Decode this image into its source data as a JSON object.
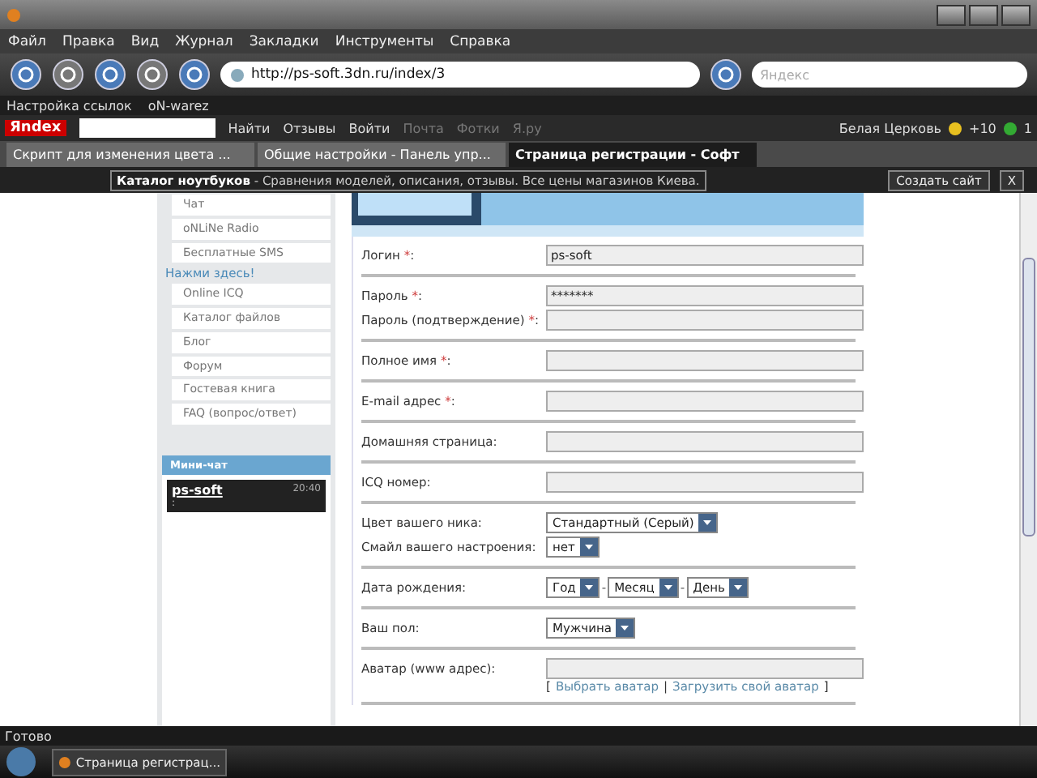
{
  "menu": [
    {
      "label": "Файл"
    },
    {
      "label": "Правка"
    },
    {
      "label": "Вид"
    },
    {
      "label": "Журнал"
    },
    {
      "label": "Закладки"
    },
    {
      "label": "Инструменты"
    },
    {
      "label": "Справка"
    }
  ],
  "nav": {
    "url": "http://ps-soft.3dn.ru/index/3",
    "search_placeholder": "Яндекс"
  },
  "bookmarks": [
    {
      "label": "Настройка ссылок"
    },
    {
      "label": "oN-warez"
    }
  ],
  "yandex_bar": {
    "logo": "Яndex",
    "find": "Найти",
    "items": [
      {
        "label": "Отзывы",
        "disabled": false
      },
      {
        "label": "Войти",
        "disabled": false
      },
      {
        "label": "Почта",
        "disabled": true
      },
      {
        "label": "Фотки",
        "disabled": true
      },
      {
        "label": "Я.ру",
        "disabled": true
      }
    ],
    "city": "Белая Церковь",
    "score": "+10",
    "count": "1"
  },
  "tabs": [
    {
      "label": "Скрипт для изменения цвета ...",
      "selected": false
    },
    {
      "label": "Общие настройки - Панель упр...",
      "selected": false
    },
    {
      "label": "Страница регистрации - Софт",
      "selected": true
    }
  ],
  "notice": {
    "title": "Каталог ноутбуков",
    "text": " - Сравнения моделей, описания, отзывы. Все цены магазинов Киева.",
    "button": "Создать сайт",
    "close": "X"
  },
  "sidebar": {
    "items_top": [
      {
        "label": "Чат"
      },
      {
        "label": "oNLiNe Radio"
      },
      {
        "label": "Бесплатные SMS"
      }
    ],
    "heading": "Нажми здесь!",
    "items": [
      {
        "label": "Online ICQ"
      },
      {
        "label": "Каталог файлов"
      },
      {
        "label": "Блог"
      },
      {
        "label": "Форум"
      },
      {
        "label": "Гостевая книга"
      },
      {
        "label": "FAQ (вопрос/ответ)"
      }
    ],
    "minichat": {
      "title": "Мини-чат",
      "user": "ps-soft",
      "time": "20:40",
      "text": ":"
    }
  },
  "form": [
    [
      {
        "label": "Логин ",
        "star": "*",
        "tail": ":",
        "controls": [
          {
            "kind": "input",
            "value": "ps-soft"
          }
        ]
      }
    ],
    [
      {
        "label": "Пароль ",
        "star": "*",
        "tail": ":",
        "controls": [
          {
            "kind": "input",
            "value": "*******"
          }
        ]
      },
      {
        "label": "Пароль (подтверждение) ",
        "star": "*",
        "tail": ":",
        "controls": [
          {
            "kind": "input"
          }
        ]
      }
    ],
    [
      {
        "label": "Полное имя ",
        "star": "*",
        "tail": ":",
        "controls": [
          {
            "kind": "input"
          }
        ]
      }
    ],
    [
      {
        "label": "E-mail адрес ",
        "star": "*",
        "tail": ":",
        "controls": [
          {
            "kind": "input"
          }
        ]
      }
    ],
    [
      {
        "label": "Домашняя страница:",
        "controls": [
          {
            "kind": "input"
          }
        ]
      }
    ],
    [
      {
        "label": "ICQ номер:",
        "controls": [
          {
            "kind": "input"
          }
        ]
      }
    ],
    [
      {
        "label": "Цвет вашего ника:",
        "controls": [
          {
            "kind": "select",
            "value": "Стандартный (Серый)"
          }
        ]
      },
      {
        "label": "Смайл вашего настроения:",
        "controls": [
          {
            "kind": "select",
            "value": "нет"
          }
        ]
      }
    ],
    [
      {
        "label": "Дата рождения:",
        "controls": [
          {
            "kind": "select",
            "value": "Год"
          },
          {
            "kind": "sep",
            "text": "-"
          },
          {
            "kind": "select",
            "value": "Месяц"
          },
          {
            "kind": "sep",
            "text": "-"
          },
          {
            "kind": "select",
            "value": "День"
          }
        ]
      }
    ],
    [
      {
        "label": "Ваш пол:",
        "controls": [
          {
            "kind": "select",
            "value": "Мужчина"
          }
        ]
      }
    ],
    [
      {
        "label": "Аватар (www адрес):",
        "controls": [
          {
            "kind": "input"
          }
        ],
        "links": [
          {
            "kind": "bracket",
            "text": "["
          },
          {
            "kind": "link",
            "text": "Выбрать аватар"
          },
          {
            "kind": "bracket",
            "text": "|"
          },
          {
            "kind": "link",
            "text": "Загрузить свой аватар"
          },
          {
            "kind": "bracket",
            "text": "]"
          }
        ]
      }
    ]
  ],
  "status": "Готово",
  "taskbar": [
    {
      "label": "Страница регистрац..."
    }
  ]
}
